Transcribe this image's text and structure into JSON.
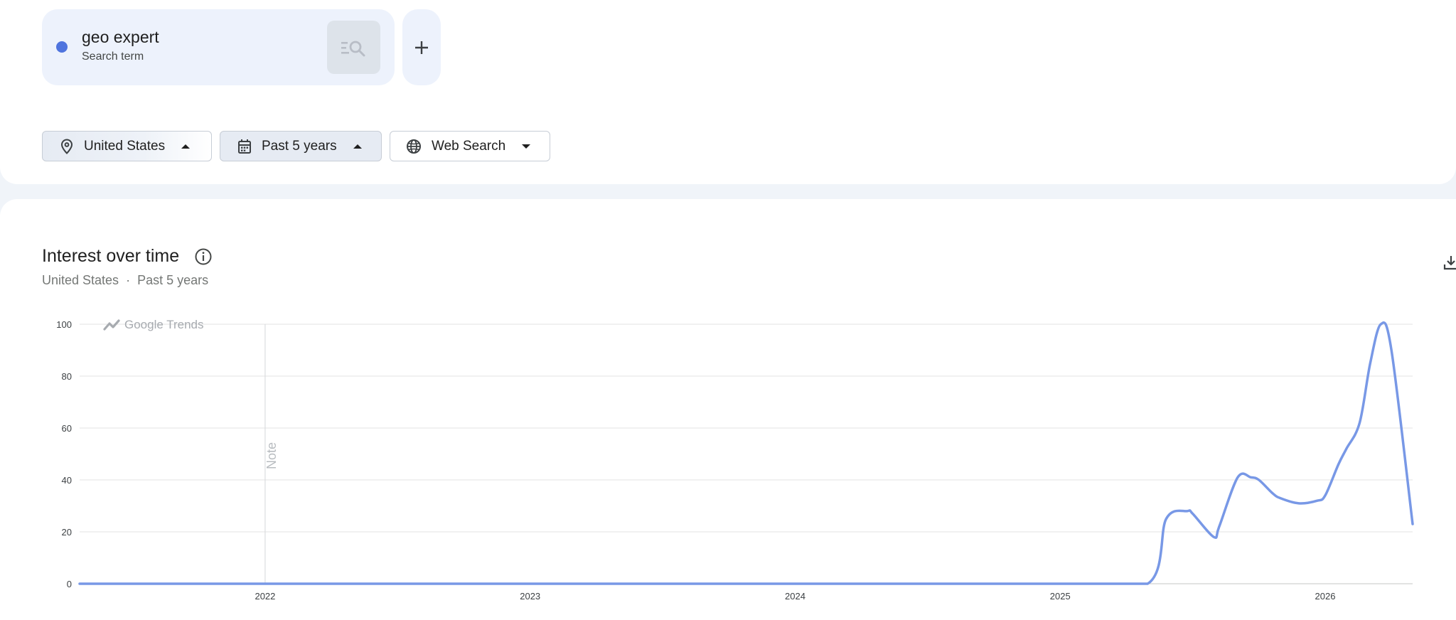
{
  "search_term": {
    "name": "geo expert",
    "type_label": "Search term",
    "color": "#4f74de"
  },
  "filters": {
    "location": "United States",
    "time_range": "Past 5 years",
    "property": "Web Search"
  },
  "interest_panel": {
    "title": "Interest over time",
    "subtitle_location": "United States",
    "subtitle_separator": "·",
    "subtitle_time": "Past 5 years",
    "watermark": "Google Trends",
    "note_label": "Note"
  },
  "icons": {
    "location": "location-pin-icon",
    "time": "calendar-icon",
    "property": "globe-icon",
    "compare": "compare-search-icon",
    "add": "plus-icon",
    "info": "info-icon",
    "download": "download-icon"
  },
  "chart_data": {
    "type": "line",
    "title": "Interest over time",
    "xlabel": "",
    "ylabel": "",
    "ylim": [
      0,
      100
    ],
    "yticks": [
      0,
      20,
      40,
      60,
      80,
      100
    ],
    "xlim": [
      2021.3,
      2026.33
    ],
    "xticks": [
      {
        "value": 2022,
        "label": "2022"
      },
      {
        "value": 2023,
        "label": "2023"
      },
      {
        "value": 2024,
        "label": "2024"
      },
      {
        "value": 2025,
        "label": "2025"
      },
      {
        "value": 2026,
        "label": "2026"
      }
    ],
    "grid": true,
    "note_at": 2022,
    "series": [
      {
        "name": "geo expert",
        "color": "#7898e6",
        "x": [
          2021.3,
          2022.0,
          2023.0,
          2024.0,
          2025.0,
          2025.33,
          2025.4,
          2025.48,
          2025.5,
          2025.58,
          2025.6,
          2025.67,
          2025.72,
          2025.75,
          2025.8,
          2025.83,
          2025.9,
          2025.97,
          2026.0,
          2026.05,
          2026.08,
          2026.13,
          2026.17,
          2026.21,
          2026.25,
          2026.33
        ],
        "values": [
          0,
          0,
          0,
          0,
          0,
          0,
          25,
          28,
          27,
          18,
          22,
          41,
          41,
          40,
          35,
          33,
          31,
          32,
          34,
          46,
          52,
          62,
          85,
          100,
          90,
          23
        ]
      }
    ]
  }
}
